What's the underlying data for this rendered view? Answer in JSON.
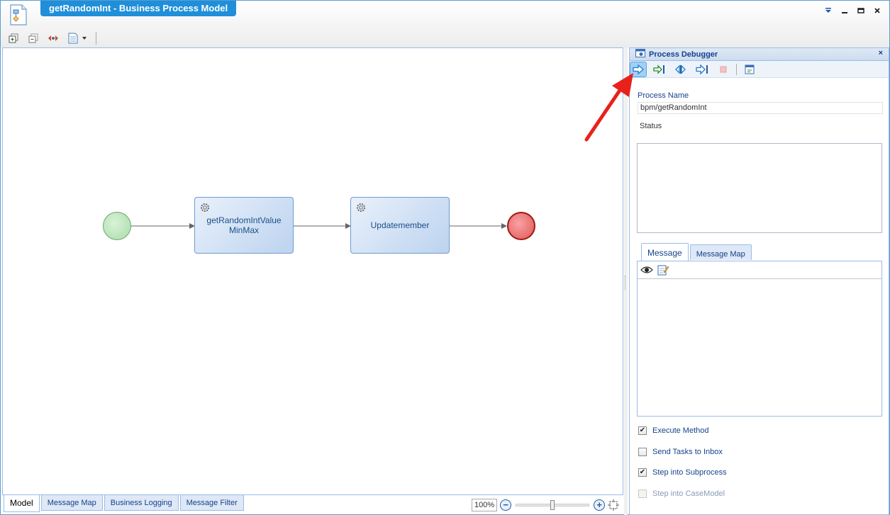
{
  "window": {
    "title": "getRandomInt - Business Process Model",
    "controls": [
      "menu-icon",
      "minimize-icon",
      "restore-icon",
      "close-icon"
    ]
  },
  "toolbar": {
    "icons": [
      "expand-all-icon",
      "collapse-all-icon",
      "diagram-icon",
      "document-dropdown-icon"
    ]
  },
  "model": {
    "nodes": {
      "start": "start-event",
      "task1": "getRandomIntValueMinMax",
      "task2": "Updatemember",
      "end": "end-event"
    }
  },
  "bottom_tabs": [
    "Model",
    "Message Map",
    "Business Logging",
    "Message Filter"
  ],
  "zoom": {
    "value": "100%",
    "level_percent": 100
  },
  "debugger": {
    "title": "Process Debugger",
    "close": "×",
    "toolbar_icons": [
      "start-debug-icon",
      "step-into-icon",
      "step-over-icon",
      "continue-icon",
      "stop-icon",
      "inspect-icon"
    ],
    "process_name_label": "Process Name",
    "process_name_value": "bpm/getRandomInt",
    "status_label": "Status",
    "message_tabs": [
      "Message",
      "Message Map"
    ],
    "message_tools": [
      "view-icon",
      "edit-icon"
    ],
    "options": [
      {
        "label": "Execute Method",
        "checked": true,
        "enabled": true
      },
      {
        "label": "Send Tasks to Inbox",
        "checked": false,
        "enabled": true
      },
      {
        "label": "Step into Subprocess",
        "checked": true,
        "enabled": true
      },
      {
        "label": "Step into CaseModel",
        "checked": false,
        "enabled": false
      }
    ]
  },
  "colors": {
    "accent": "#1f8fd9",
    "annotation_arrow": "#e8211c",
    "start_event": "#a9dca9",
    "end_event": "#e25555"
  }
}
